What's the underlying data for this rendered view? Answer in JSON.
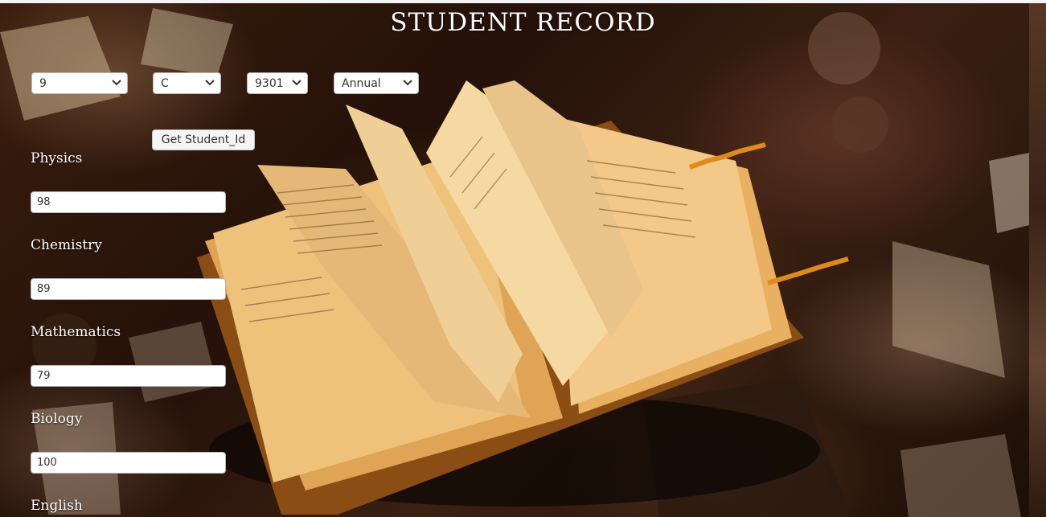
{
  "title": "STUDENT RECORD",
  "filters": {
    "class": "9",
    "section": "C",
    "student_id": "9301",
    "exam": "Annual"
  },
  "get_button_label": "Get Student_Id",
  "subjects": [
    {
      "label": "Physics",
      "value": "98"
    },
    {
      "label": "Chemistry",
      "value": "89"
    },
    {
      "label": "Mathematics",
      "value": "79"
    },
    {
      "label": "Biology",
      "value": "100"
    },
    {
      "label": "English",
      "value": ""
    }
  ],
  "icons": {
    "dropdown": "chevron-down-icon",
    "background": "open-book-image"
  }
}
